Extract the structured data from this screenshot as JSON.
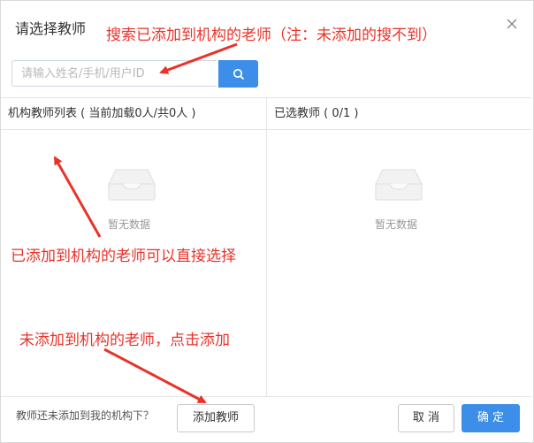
{
  "dialog": {
    "title": "请选择教师",
    "close_icon": "close-icon"
  },
  "search": {
    "placeholder": "请输入姓名/手机/用户ID",
    "value": "",
    "button_icon": "search-icon"
  },
  "left_panel": {
    "header": "机构教师列表 ( 当前加载0人/共0人 )",
    "empty_text": "暂无数据",
    "empty_icon": "inbox-icon"
  },
  "right_panel": {
    "header": "已选教师 ( 0/1 )",
    "empty_text": "暂无数据",
    "empty_icon": "inbox-icon"
  },
  "footer": {
    "hint": "教师还未添加到我的机构下？",
    "add_button": "添加教师",
    "cancel_button": "取 消",
    "ok_button": "确 定"
  },
  "annotations": {
    "search_note": "搜索已添加到机构的老师（注：未添加的搜不到）",
    "select_note": "已添加到机构的老师可以直接选择",
    "add_note": "未添加到机构的老师，点击添加",
    "color": "#e8332a"
  },
  "colors": {
    "primary": "#3d8ee9",
    "border": "#e5e5e5"
  }
}
